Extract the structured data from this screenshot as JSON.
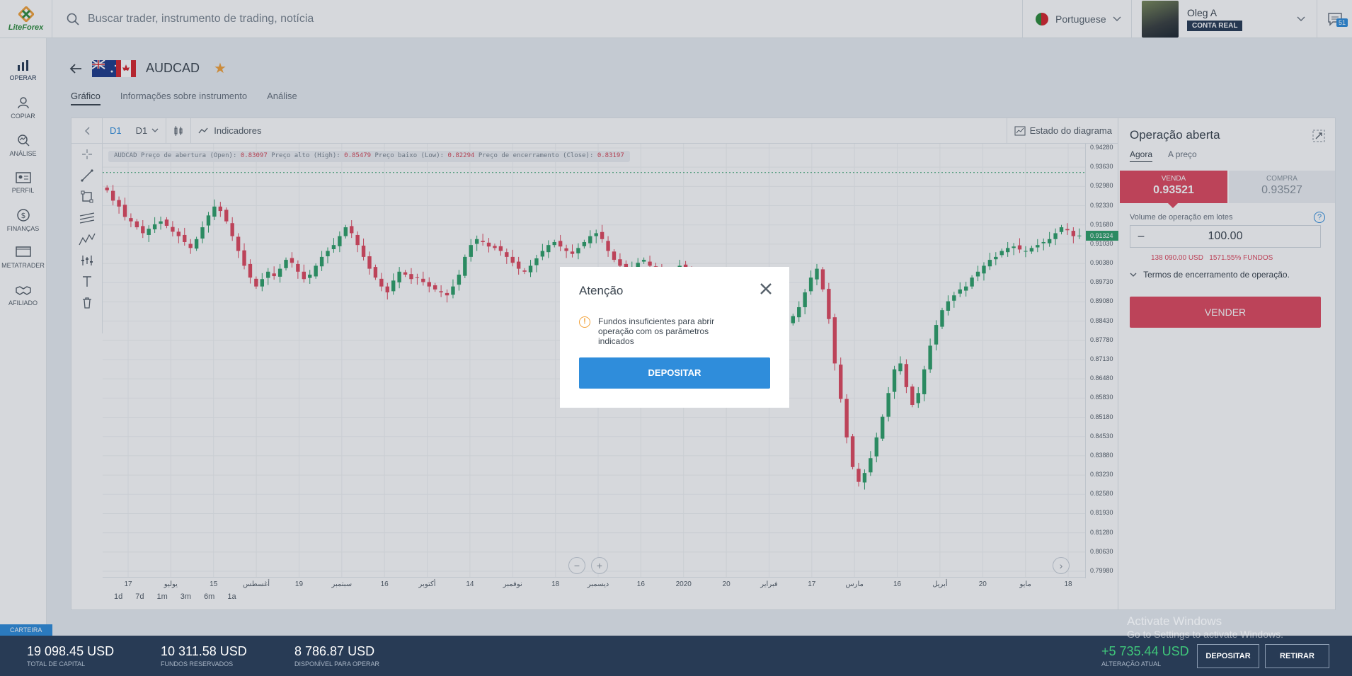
{
  "header": {
    "logo": "LiteForex",
    "search_placeholder": "Buscar trader, instrumento de trading, notícia",
    "language": "Portuguese",
    "user_name": "Oleg A",
    "account_badge": "CONTA REAL",
    "messages_count": "51"
  },
  "sidebar": {
    "items": [
      {
        "label": "OPERAR",
        "icon": "chart-bars-icon"
      },
      {
        "label": "COPIAR",
        "icon": "person-icon"
      },
      {
        "label": "ANÁLISE",
        "icon": "analysis-icon"
      },
      {
        "label": "PERFIL",
        "icon": "profile-card-icon"
      },
      {
        "label": "FINANÇAS",
        "icon": "dollar-icon"
      },
      {
        "label": "METATRADER",
        "icon": "monitor-icon"
      },
      {
        "label": "AFILIADO",
        "icon": "handshake-icon"
      }
    ],
    "portfolio_tab": "CARTEIRA"
  },
  "instrument": {
    "name": "AUDCAD",
    "tabs": [
      "Gráfico",
      "Informações sobre instrumento",
      "Análise"
    ]
  },
  "chart_toolbar": {
    "period": "D1",
    "timeframe": "D1",
    "indicators": "Indicadores",
    "diagram_state": "Estado do diagrama"
  },
  "chart_info": {
    "symbol": "AUDCAD",
    "open_label": "Preço de abertura (Open):",
    "open": "0.83097",
    "high_label": "Preço alto (High):",
    "high": "0.85479",
    "low_label": "Preço baixo (Low):",
    "low": "0.82294",
    "close_label": "Preço de encerramento (Close):",
    "close": "0.83197"
  },
  "chart_data": {
    "type": "candlestick",
    "y_ticks": [
      "0.94280",
      "0.93630",
      "0.92980",
      "0.92330",
      "0.91680",
      "0.91030",
      "0.90380",
      "0.89730",
      "0.89080",
      "0.88430",
      "0.87780",
      "0.87130",
      "0.86480",
      "0.85830",
      "0.85180",
      "0.84530",
      "0.83880",
      "0.83230",
      "0.82580",
      "0.81930",
      "0.81280",
      "0.80630",
      "0.79980"
    ],
    "current_price": "0.91324",
    "ylim": [
      0.7998,
      0.9428
    ],
    "x_ticks": [
      "17",
      "يوليو",
      "15",
      "أغسطس",
      "19",
      "سبتمبر",
      "16",
      "أكتوبر",
      "14",
      "نوفمبر",
      "18",
      "ديسمبر",
      "16",
      "2020",
      "20",
      "فبراير",
      "17",
      "مارس",
      "16",
      "أبريل",
      "20",
      "مايو",
      "18"
    ],
    "closes": [
      0.9285,
      0.925,
      0.923,
      0.9195,
      0.918,
      0.916,
      0.914,
      0.9155,
      0.917,
      0.918,
      0.9165,
      0.9145,
      0.913,
      0.911,
      0.909,
      0.912,
      0.916,
      0.92,
      0.923,
      0.9215,
      0.918,
      0.913,
      0.908,
      0.903,
      0.899,
      0.896,
      0.8985,
      0.901,
      0.8995,
      0.902,
      0.905,
      0.904,
      0.901,
      0.8985,
      0.9,
      0.903,
      0.906,
      0.908,
      0.91,
      0.913,
      0.916,
      0.914,
      0.91,
      0.906,
      0.902,
      0.899,
      0.896,
      0.894,
      0.898,
      0.901,
      0.9,
      0.8985,
      0.899,
      0.8975,
      0.896,
      0.895,
      0.894,
      0.893,
      0.896,
      0.9,
      0.906,
      0.91,
      0.912,
      0.911,
      0.9095,
      0.909,
      0.908,
      0.906,
      0.904,
      0.902,
      0.901,
      0.903,
      0.9055,
      0.908,
      0.91,
      0.911,
      0.9095,
      0.908,
      0.907,
      0.909,
      0.911,
      0.913,
      0.914,
      0.912,
      0.908,
      0.905,
      0.903,
      0.901,
      0.902,
      0.904,
      0.905,
      0.903,
      0.901,
      0.9,
      0.899,
      0.901,
      0.903,
      0.901,
      0.899,
      0.898,
      0.898,
      0.899,
      0.898,
      0.896,
      0.893,
      0.89,
      0.887,
      0.884,
      0.881,
      0.879,
      0.877,
      0.876,
      0.878,
      0.88,
      0.883,
      0.886,
      0.889,
      0.894,
      0.899,
      0.902,
      0.895,
      0.885,
      0.87,
      0.858,
      0.845,
      0.835,
      0.83,
      0.833,
      0.838,
      0.845,
      0.852,
      0.86,
      0.868,
      0.87,
      0.862,
      0.856,
      0.86,
      0.868,
      0.876,
      0.883,
      0.888,
      0.891,
      0.893,
      0.895,
      0.896,
      0.899,
      0.901,
      0.903,
      0.905,
      0.906,
      0.908,
      0.909,
      0.9095,
      0.9085,
      0.908,
      0.909,
      0.91,
      0.911,
      0.912,
      0.914,
      0.916,
      0.915,
      0.913,
      0.9132
    ]
  },
  "time_ranges": [
    "1d",
    "7d",
    "1m",
    "3m",
    "6m",
    "1a"
  ],
  "order": {
    "title": "Operação aberta",
    "tabs": [
      "Agora",
      "A preço"
    ],
    "sell_label": "VENDA",
    "sell_price": "0.93521",
    "buy_label": "COMPRA",
    "buy_price": "0.93527",
    "volume_label": "Volume de operação em lotes",
    "volume": "100.00",
    "required": "138 090.00 USD",
    "funds_pct": "1571.55% FUNDOS",
    "terms": "Termos de encerramento de operação.",
    "sell_button": "VENDER"
  },
  "modal": {
    "title": "Atenção",
    "message": "Fundos insuficientes para abrir operação com os parâmetros indicados",
    "button": "DEPOSITAR"
  },
  "bottom": {
    "capital": "19 098.45 USD",
    "capital_label": "TOTAL DE CAPITAL",
    "reserved": "10 311.58 USD",
    "reserved_label": "FUNDOS RESERVADOS",
    "available": "8 786.87 USD",
    "available_label": "DISPONÍVEL PARA OPERAR",
    "change": "+5 735.44 USD",
    "change_label": "ALTERAÇÃO ATUAL",
    "deposit": "DEPOSITAR",
    "withdraw": "RETIRAR"
  },
  "watermark": {
    "line1": "Activate Windows",
    "line2": "Go to Settings to activate Windows."
  },
  "colors": {
    "up": "#2fa06a",
    "down": "#e04a60",
    "accent": "#2f8ddb",
    "navy": "#283b55"
  }
}
